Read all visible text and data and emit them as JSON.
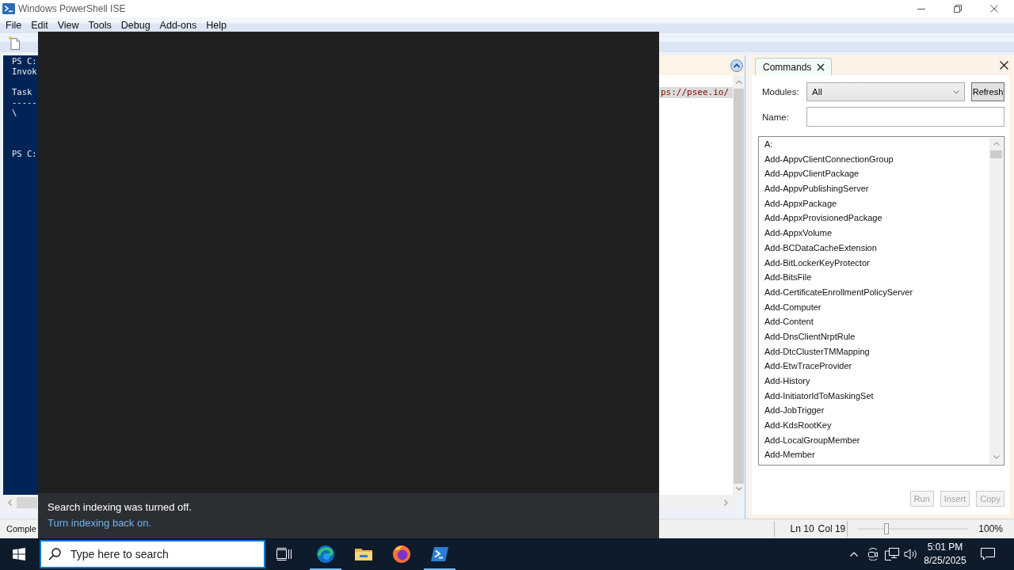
{
  "window": {
    "title": "Windows PowerShell ISE"
  },
  "menu": [
    "File",
    "Edit",
    "View",
    "Tools",
    "Debug",
    "Add-ons",
    "Help"
  ],
  "console": {
    "blocks": [
      [
        "PS C:",
        "Invok"
      ],
      [
        "Task",
        "-----",
        "\\"
      ],
      [
        "PS C:"
      ]
    ]
  },
  "script": {
    "line": "ps://psee.io/"
  },
  "commands_panel": {
    "tab": {
      "label": "Commands",
      "selected": true
    },
    "modules_label": "Modules:",
    "modules_value": "All",
    "refresh": {
      "label": "Refresh",
      "disabled": false
    },
    "name_label": "Name:",
    "items": [
      {
        "name": "A:",
        "selected": false
      },
      {
        "name": "Add-AppvClientConnectionGroup",
        "selected": false
      },
      {
        "name": "Add-AppvClientPackage",
        "selected": false
      },
      {
        "name": "Add-AppvPublishingServer",
        "selected": false
      },
      {
        "name": "Add-AppxPackage",
        "selected": false
      },
      {
        "name": "Add-AppxProvisionedPackage",
        "selected": false
      },
      {
        "name": "Add-AppxVolume",
        "selected": false
      },
      {
        "name": "Add-BCDataCacheExtension",
        "selected": false
      },
      {
        "name": "Add-BitLockerKeyProtector",
        "selected": false
      },
      {
        "name": "Add-BitsFile",
        "selected": false
      },
      {
        "name": "Add-CertificateEnrollmentPolicyServer",
        "selected": false
      },
      {
        "name": "Add-Computer",
        "selected": false
      },
      {
        "name": "Add-Content",
        "selected": false
      },
      {
        "name": "Add-DnsClientNrptRule",
        "selected": false
      },
      {
        "name": "Add-DtcClusterTMMapping",
        "selected": false
      },
      {
        "name": "Add-EtwTraceProvider",
        "selected": false
      },
      {
        "name": "Add-History",
        "selected": false
      },
      {
        "name": "Add-InitiatorIdToMaskingSet",
        "selected": false
      },
      {
        "name": "Add-JobTrigger",
        "selected": false
      },
      {
        "name": "Add-KdsRootKey",
        "selected": false
      },
      {
        "name": "Add-LocalGroupMember",
        "selected": false
      },
      {
        "name": "Add-Member",
        "selected": false
      }
    ],
    "buttons": [
      {
        "label": "Run",
        "disabled": true
      },
      {
        "label": "Insert",
        "disabled": true
      },
      {
        "label": "Copy",
        "disabled": true
      }
    ]
  },
  "status_bar": {
    "text": "Comple",
    "line": "Ln 10",
    "column": "Col 19",
    "zoom": {
      "level": 0.25
    },
    "zoom_text": "100%"
  },
  "taskbar": {
    "search": {
      "placeholder": "Type here to search"
    },
    "apps": [
      {
        "kind": "edge",
        "running": true
      },
      {
        "kind": "explorer",
        "running": false
      },
      {
        "kind": "firefox",
        "running": false
      },
      {
        "kind": "powershell",
        "running": true
      }
    ],
    "time": "5:01 PM",
    "date": "8/25/2025"
  },
  "search_flyout": {
    "notice": "Search indexing was turned off.",
    "link": "Turn indexing back on."
  }
}
